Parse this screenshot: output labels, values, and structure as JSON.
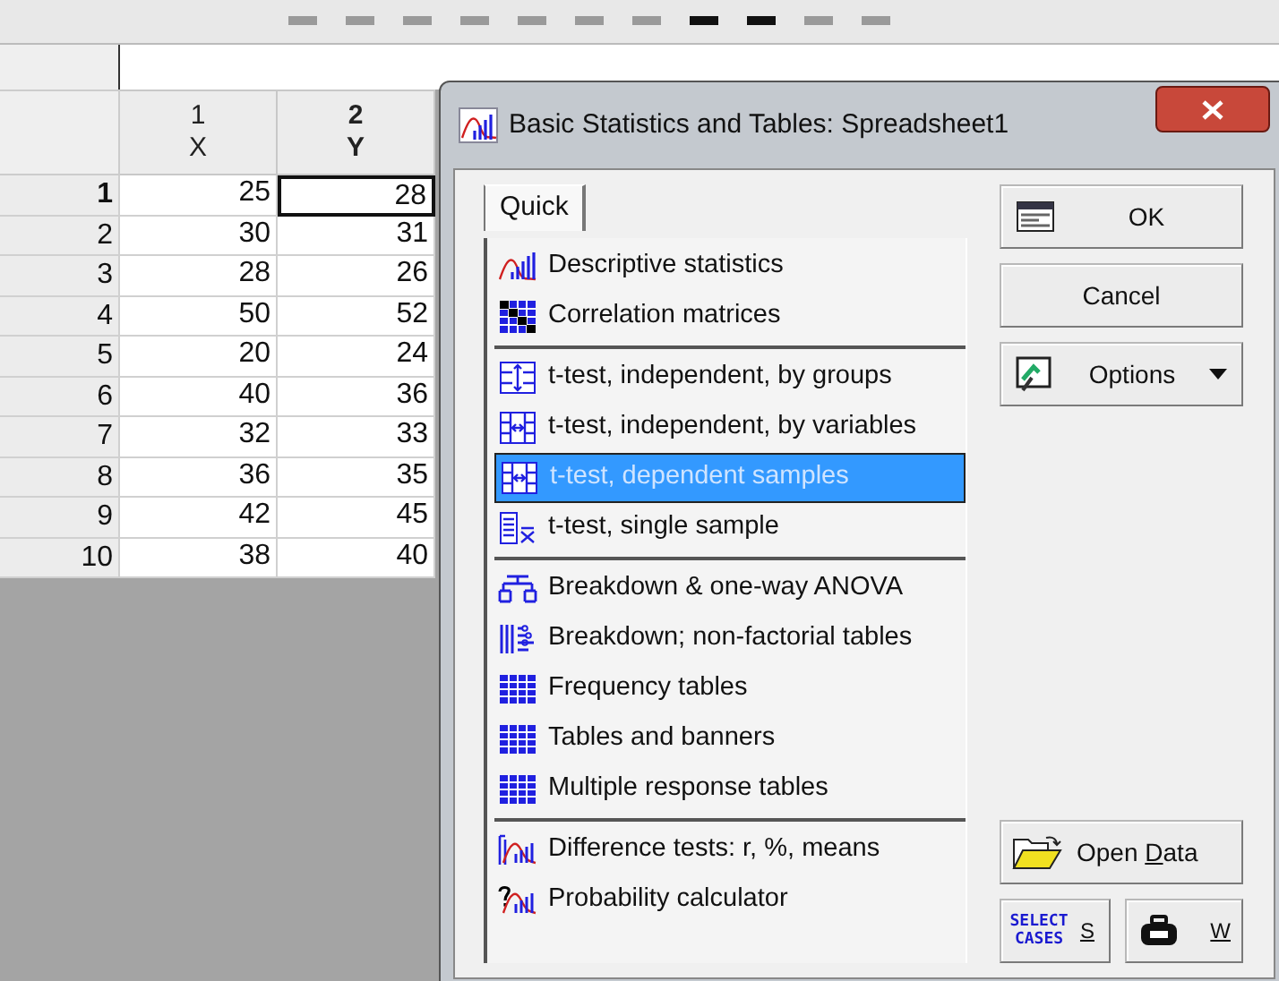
{
  "spreadsheet": {
    "columns": [
      {
        "number": "1",
        "name": "X",
        "current": false
      },
      {
        "number": "2",
        "name": "Y",
        "current": true
      }
    ],
    "rows": [
      {
        "label": "1",
        "current": true,
        "cells": [
          "25",
          "28"
        ]
      },
      {
        "label": "2",
        "current": false,
        "cells": [
          "30",
          "31"
        ]
      },
      {
        "label": "3",
        "current": false,
        "cells": [
          "28",
          "26"
        ]
      },
      {
        "label": "4",
        "current": false,
        "cells": [
          "50",
          "52"
        ]
      },
      {
        "label": "5",
        "current": false,
        "cells": [
          "20",
          "24"
        ]
      },
      {
        "label": "6",
        "current": false,
        "cells": [
          "40",
          "36"
        ]
      },
      {
        "label": "7",
        "current": false,
        "cells": [
          "32",
          "33"
        ]
      },
      {
        "label": "8",
        "current": false,
        "cells": [
          "36",
          "35"
        ]
      },
      {
        "label": "9",
        "current": false,
        "cells": [
          "42",
          "45"
        ]
      },
      {
        "label": "10",
        "current": false,
        "cells": [
          "38",
          "40"
        ]
      }
    ]
  },
  "dialog": {
    "title": "Basic Statistics and Tables: Spreadsheet1",
    "tabs": [
      {
        "label": "Quick",
        "selected": true
      }
    ],
    "groups": [
      [
        {
          "label": "Descriptive statistics",
          "kind": "chart",
          "selected": false
        },
        {
          "label": "Correlation matrices",
          "kind": "matrix",
          "selected": false
        }
      ],
      [
        {
          "label": "t-test, independent, by groups",
          "kind": "groups",
          "selected": false
        },
        {
          "label": "t-test, independent, by variables",
          "kind": "variables",
          "selected": false
        },
        {
          "label": "t-test, dependent samples",
          "kind": "variables",
          "selected": true
        },
        {
          "label": "t-test, single sample",
          "kind": "single",
          "selected": false
        }
      ],
      [
        {
          "label": "Breakdown & one-way ANOVA",
          "kind": "tree",
          "selected": false
        },
        {
          "label": "Breakdown; non-factorial tables",
          "kind": "bars",
          "selected": false
        },
        {
          "label": "Frequency tables",
          "kind": "grid",
          "selected": false
        },
        {
          "label": "Tables and banners",
          "kind": "grid",
          "selected": false
        },
        {
          "label": "Multiple response tables",
          "kind": "grid",
          "selected": false
        }
      ],
      [
        {
          "label": "Difference tests: r, %, means",
          "kind": "difference",
          "selected": false
        },
        {
          "label": "Probability calculator",
          "kind": "question",
          "selected": false
        }
      ]
    ],
    "buttons": [
      {
        "label": "OK",
        "kind": "form",
        "dropdown": false
      },
      {
        "label": "Cancel",
        "kind": "plain",
        "dropdown": false
      },
      {
        "label": "Options",
        "kind": "options",
        "dropdown": true
      }
    ],
    "open_data": {
      "before": "Open ",
      "mnemonic": "D",
      "after": "ata"
    },
    "select_cases": {
      "icon_text": "SELECT CASES",
      "label": "S"
    },
    "weight": {
      "label": "W"
    }
  }
}
